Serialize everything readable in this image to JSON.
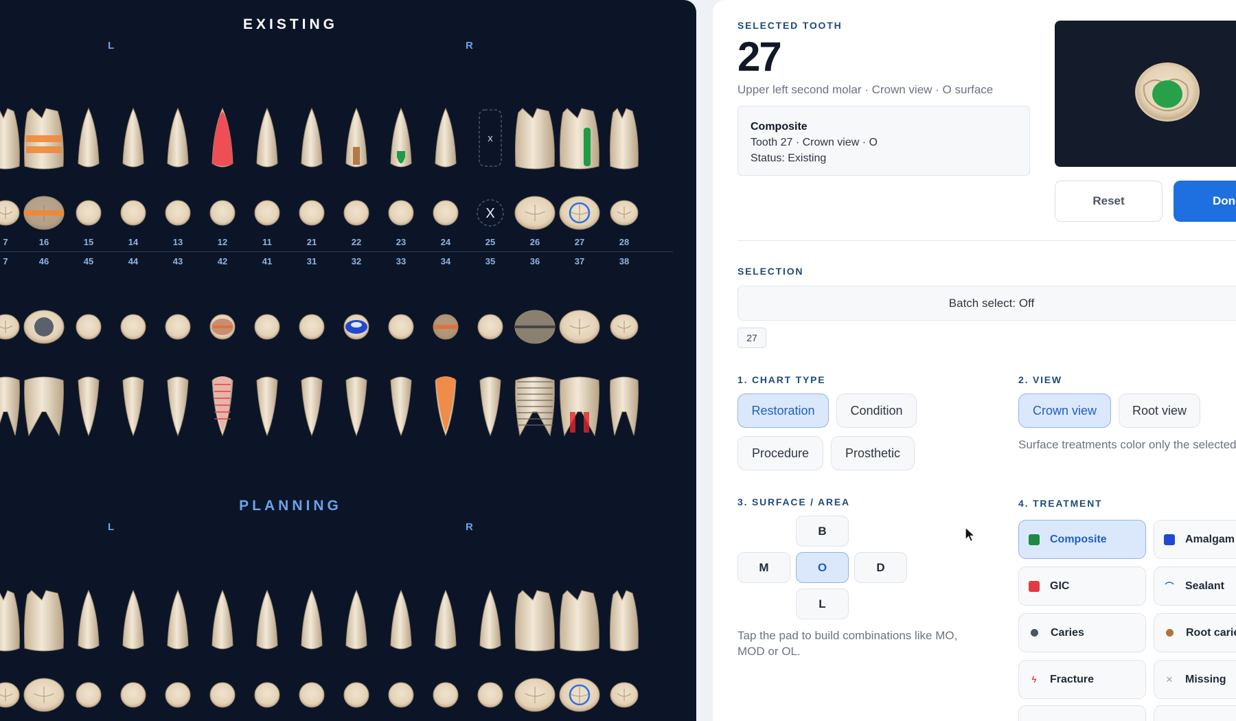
{
  "chart": {
    "existing_title": "EXISTING",
    "planning_title": "PLANNING",
    "left_marker": "L",
    "right_marker": "R",
    "upper_numbers": [
      "7",
      "16",
      "15",
      "14",
      "13",
      "12",
      "11",
      "21",
      "22",
      "23",
      "24",
      "25",
      "26",
      "27",
      "28"
    ],
    "lower_numbers": [
      "7",
      "46",
      "45",
      "44",
      "43",
      "42",
      "41",
      "31",
      "32",
      "33",
      "34",
      "35",
      "36",
      "37",
      "38"
    ],
    "missing_marker": "x",
    "missing_marker_occlusal": "X"
  },
  "panel": {
    "selected_label": "SELECTED TOOTH",
    "tooth_number": "27",
    "tooth_desc": "Upper left second molar · Crown view · O surface",
    "card": {
      "title": "Composite",
      "line1": "Tooth 27 · Crown view · O",
      "line2": "Status: Existing"
    },
    "reset_label": "Reset",
    "done_label": "Done",
    "selection_label": "SELECTION",
    "batch_label": "Batch select: Off",
    "selected_chip": "27",
    "chart_type_label": "1. CHART TYPE",
    "chart_types": [
      "Restoration",
      "Condition",
      "Procedure",
      "Prosthetic"
    ],
    "view_label": "2. VIEW",
    "views": [
      "Crown view",
      "Root view"
    ],
    "view_help": "Surface treatments color only the selected region.",
    "surface_label": "3. SURFACE / AREA",
    "surfaces": {
      "b": "B",
      "m": "M",
      "o": "O",
      "d": "D",
      "l": "L"
    },
    "surface_help": "Tap the pad to build combinations like MO, MOD or OL.",
    "treatment_label": "4. TREATMENT",
    "treatments": [
      {
        "label": "Composite",
        "color": "#1e8a45",
        "active": true
      },
      {
        "label": "Amalgam",
        "color": "#2048d0",
        "active": false
      },
      {
        "label": "GIC",
        "color": "#e23a42",
        "active": false
      },
      {
        "label": "Sealant",
        "color": "#2b6cd8",
        "active": false
      },
      {
        "label": "Caries",
        "color": "#4b5563",
        "active": false
      },
      {
        "label": "Root caries",
        "color": "#b5713a",
        "active": false
      },
      {
        "label": "Fracture",
        "color": "#e23a42",
        "active": false
      },
      {
        "label": "Missing",
        "color": "#9ca3af",
        "active": false
      }
    ]
  }
}
